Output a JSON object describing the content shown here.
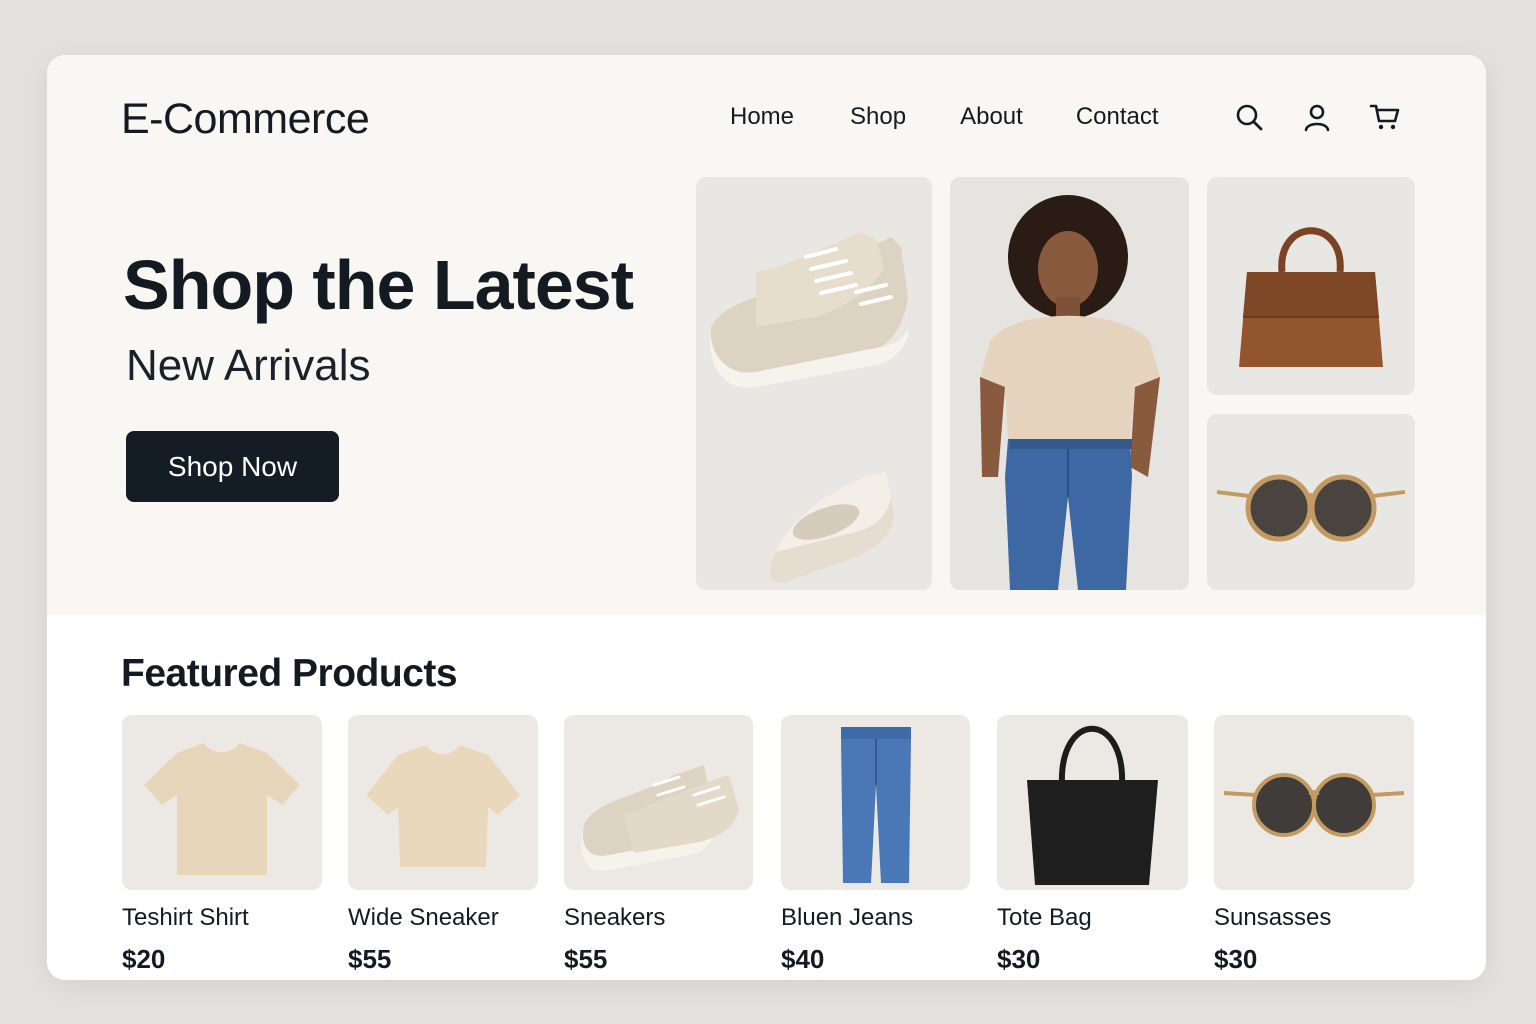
{
  "brand": "E-Commerce",
  "nav": [
    "Home",
    "Shop",
    "About",
    "Contact"
  ],
  "header_icons": [
    "search-icon",
    "user-icon",
    "cart-icon"
  ],
  "hero": {
    "title": "Shop the Latest",
    "subtitle": "New Arrivals",
    "cta": "Shop Now"
  },
  "featured": {
    "title": "Featured Products",
    "products": [
      {
        "name": "Teshirt Shirt",
        "price": "$20"
      },
      {
        "name": "Wide Sneaker",
        "price": "$55"
      },
      {
        "name": "Sneakers",
        "price": "$55"
      },
      {
        "name": "Bluen Jeans",
        "price": "$40"
      },
      {
        "name": "Tote Bag",
        "price": "$30"
      },
      {
        "name": "Sunsasses",
        "price": "$30"
      }
    ]
  },
  "colors": {
    "text": "#141a21",
    "button": "#141d26",
    "page_bg": "#e4e2de",
    "card_bg": "#fbfaf7"
  }
}
